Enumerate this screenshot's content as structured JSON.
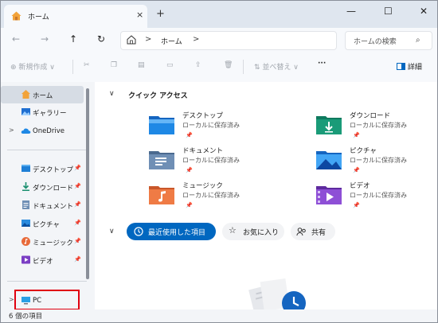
{
  "tab": {
    "title": "ホーム",
    "close": "×",
    "new": "+"
  },
  "window_controls": {
    "minimize": "—",
    "maximize": "☐",
    "close": "✕"
  },
  "nav": {
    "back": "←",
    "forward": "→",
    "up": "↑",
    "refresh": "↻"
  },
  "address": {
    "sep1": ">",
    "location": "ホーム",
    "sep2": ">"
  },
  "search": {
    "placeholder": "ホームの検索",
    "icon": "⌕"
  },
  "toolbar": {
    "new_label": "新規作成",
    "sort_label": "並べ替え",
    "more": "···",
    "details_label": "詳細"
  },
  "sidebar": {
    "items": [
      {
        "label": "ホーム"
      },
      {
        "label": "ギャラリー"
      },
      {
        "label": "OneDrive"
      },
      {
        "label": "デスクトップ"
      },
      {
        "label": "ダウンロード"
      },
      {
        "label": "ドキュメント"
      },
      {
        "label": "ピクチャ"
      },
      {
        "label": "ミュージック"
      },
      {
        "label": "ビデオ"
      },
      {
        "label": "PC"
      }
    ],
    "chevron": ">",
    "pin": "📌"
  },
  "status": {
    "text": "6 個の項目"
  },
  "main": {
    "quick_access_title": "クイック アクセス",
    "quick_items": [
      {
        "name": "デスクトップ",
        "sub": "ローカルに保存済み"
      },
      {
        "name": "ダウンロード",
        "sub": "ローカルに保存済み"
      },
      {
        "name": "ドキュメント",
        "sub": "ローカルに保存済み"
      },
      {
        "name": "ピクチャ",
        "sub": "ローカルに保存済み"
      },
      {
        "name": "ミュージック",
        "sub": "ローカルに保存済み"
      },
      {
        "name": "ビデオ",
        "sub": "ローカルに保存済み"
      }
    ],
    "pills": {
      "recent": "最近使用した項目",
      "favorites": "お気に入り",
      "shared": "共有"
    },
    "chevron_down": "∨"
  },
  "colors": {
    "accent": "#0067c0",
    "highlight": "#e0000f"
  }
}
